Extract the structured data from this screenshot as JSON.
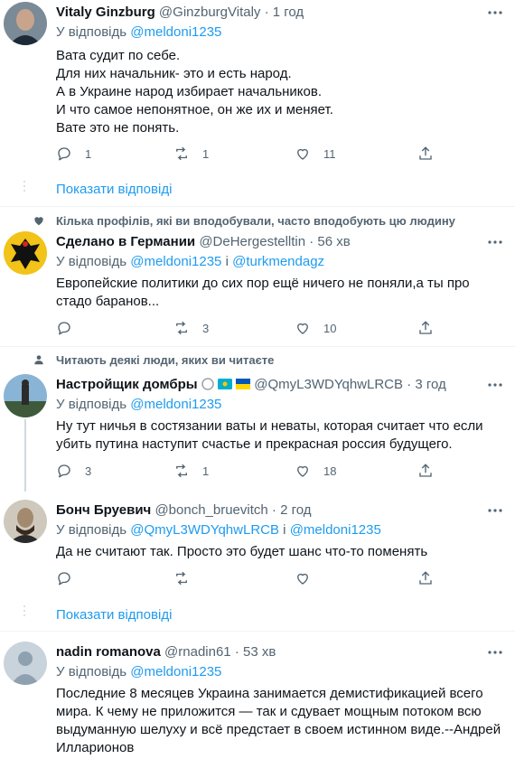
{
  "colors": {
    "accent": "#1d9bf0",
    "secondary": "#536471",
    "text": "#0f1419",
    "divider": "#eff3f4"
  },
  "show_replies": "Показати відповіді",
  "tweets": [
    {
      "name": "Vitaly Ginzburg",
      "handle": "@GinzburgVitaly",
      "time": "· 1 год",
      "reply_prefix": "У відповідь",
      "reply_to": "@meldoni1235",
      "text": [
        "Вата судит по себе.",
        "Для них начальник- это и есть народ.",
        "А в Украине народ избирает начальников.",
        "И что самое непонятное, он же их и меняет.",
        "Вате это не понять."
      ],
      "replies": "1",
      "retweets": "1",
      "likes": "11"
    },
    {
      "social": "Кілька профілів, які ви вподобували, часто вподобують цю людину",
      "name": "Сделано в Германии",
      "handle": "@DeHergestelltin",
      "time": "· 56 хв",
      "reply_prefix": "У відповідь",
      "reply_to": "@meldoni1235",
      "reply_and": "і",
      "reply_to2": "@turkmendagz",
      "text": [
        "Европейские политики до сих пор ещё ничего не поняли,а ты про",
        "стадо баранов..."
      ],
      "replies": "",
      "retweets": "3",
      "likes": "10"
    },
    {
      "social": "Читають деякі люди, яких ви читаєте",
      "name": "Настройщик домбры",
      "handle": "@QmyL3WDYqhwLRCB",
      "time": "· 3 год",
      "reply_prefix": "У відповідь",
      "reply_to": "@meldoni1235",
      "text": [
        "Ну тут ничья в состязании ваты и неваты, которая считает что если",
        "убить путина наступит счастье и прекрасная россия будущего."
      ],
      "replies": "3",
      "retweets": "1",
      "likes": "18"
    },
    {
      "name": "Бонч Бруевич",
      "handle": "@bonch_bruevitch",
      "time": "· 2 год",
      "reply_prefix": "У відповідь",
      "reply_to": "@QmyL3WDYqhwLRCB",
      "reply_and": "і",
      "reply_to2": "@meldoni1235",
      "text": [
        "Да не считают так. Просто это будет шанс что-то поменять"
      ],
      "replies": "",
      "retweets": "",
      "likes": ""
    },
    {
      "name": "nadin romanova",
      "handle": "@rnadin61",
      "time": "· 53 хв",
      "reply_prefix": "У відповідь",
      "reply_to": "@meldoni1235",
      "text": [
        "Последние 8 месяцев Украина занимается демистификацией всего",
        "мира. К чему не приложится — так и сдувает мощным потоком всю",
        "выдуманную шелуху и всё предстает в своем истинном виде.--Андрей",
        "Илларионов"
      ]
    }
  ]
}
